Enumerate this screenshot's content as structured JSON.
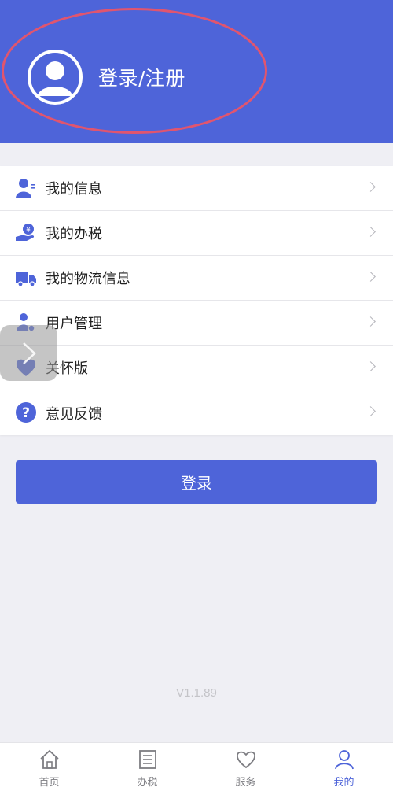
{
  "header": {
    "login_register_label": "登录/注册",
    "avatar_icon": "user-avatar-icon"
  },
  "menu": [
    {
      "label": "我的信息",
      "icon": "user-info-icon"
    },
    {
      "label": "我的办税",
      "icon": "tax-hand-icon"
    },
    {
      "label": "我的物流信息",
      "icon": "truck-icon"
    },
    {
      "label": "用户管理",
      "icon": "user-settings-icon"
    },
    {
      "label": "关怀版",
      "icon": "heart-care-icon"
    },
    {
      "label": "意见反馈",
      "icon": "question-icon"
    }
  ],
  "login_button": "登录",
  "version": "V1.1.89",
  "tabbar": [
    {
      "label": "首页",
      "icon": "home-icon",
      "active": false
    },
    {
      "label": "办税",
      "icon": "list-icon",
      "active": false
    },
    {
      "label": "服务",
      "icon": "heart-icon",
      "active": false
    },
    {
      "label": "我的",
      "icon": "person-icon",
      "active": true
    }
  ],
  "colors": {
    "primary": "#4e64d9",
    "annotation_ellipse": "#e0556f",
    "background": "#efeff4"
  }
}
